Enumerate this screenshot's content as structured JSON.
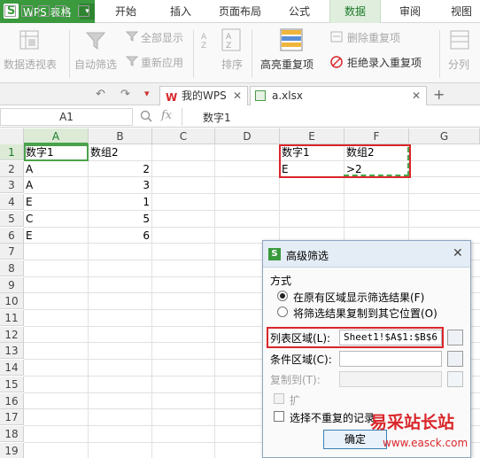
{
  "app": {
    "logo": "S",
    "name": "WPS 表格",
    "dropdown_glyph": "▾"
  },
  "menu_tabs": [
    "开始",
    "插入",
    "页面布局",
    "公式",
    "数据",
    "审阅",
    "视图"
  ],
  "active_tab": "数据",
  "ribbon": {
    "pivot_table": "数据透视表",
    "auto_filter": "自动筛选",
    "show_all": "全部显示",
    "reapply": "重新应用",
    "sort": "排序",
    "highlight_duplicates": "高亮重复项",
    "remove_duplicates": "删除重复项",
    "reject_duplicates": "拒绝录入重复项",
    "split": "分列"
  },
  "doc_tabs": [
    {
      "label": "我的WPS",
      "icon": "wps-logo-icon"
    },
    {
      "label": "a.xlsx",
      "icon": "spreadsheet-file-icon"
    }
  ],
  "name_box": "A1",
  "formula_icons": {
    "zoom": "zoom-icon",
    "fx": "fx"
  },
  "formula_value": "数字1",
  "columns": [
    "A",
    "B",
    "C",
    "D",
    "E",
    "F",
    "G"
  ],
  "rows": [
    "1",
    "2",
    "3",
    "4",
    "5",
    "6",
    "7",
    "8",
    "9",
    "10",
    "11",
    "12",
    "13",
    "14",
    "15",
    "16",
    "17",
    "18",
    "19"
  ],
  "cells": {
    "A1": "数字1",
    "B1": "数组2",
    "A2": "A",
    "B2": "2",
    "A3": "A",
    "B3": "3",
    "A4": "E",
    "B4": "1",
    "A5": "C",
    "B5": "5",
    "A6": "E",
    "B6": "6",
    "E1": "数字1",
    "F1": "数组2",
    "E2": "E",
    "F2": ">2"
  },
  "dialog": {
    "title": "高级筛选",
    "section": "方式",
    "option_in_place": "在原有区域显示筛选结果(F)",
    "option_copy": "将筛选结果复制到其它位置(O)",
    "list_range_label": "列表区域(L):",
    "list_range_value": "Sheet1!$A$1:$B$6",
    "criteria_label": "条件区域(C):",
    "criteria_value": "",
    "copy_to_label": "复制到(T):",
    "copy_to_value": "",
    "expand_label": "扩",
    "unique_label": "选择不重复的记录",
    "ok_label": "确定"
  },
  "watermark": "易采站长站",
  "watermark_url": "www.easck.com",
  "colors": {
    "brand": "#3a9a3d",
    "highlight": "#d9262a",
    "watermark": "#d9262a"
  }
}
